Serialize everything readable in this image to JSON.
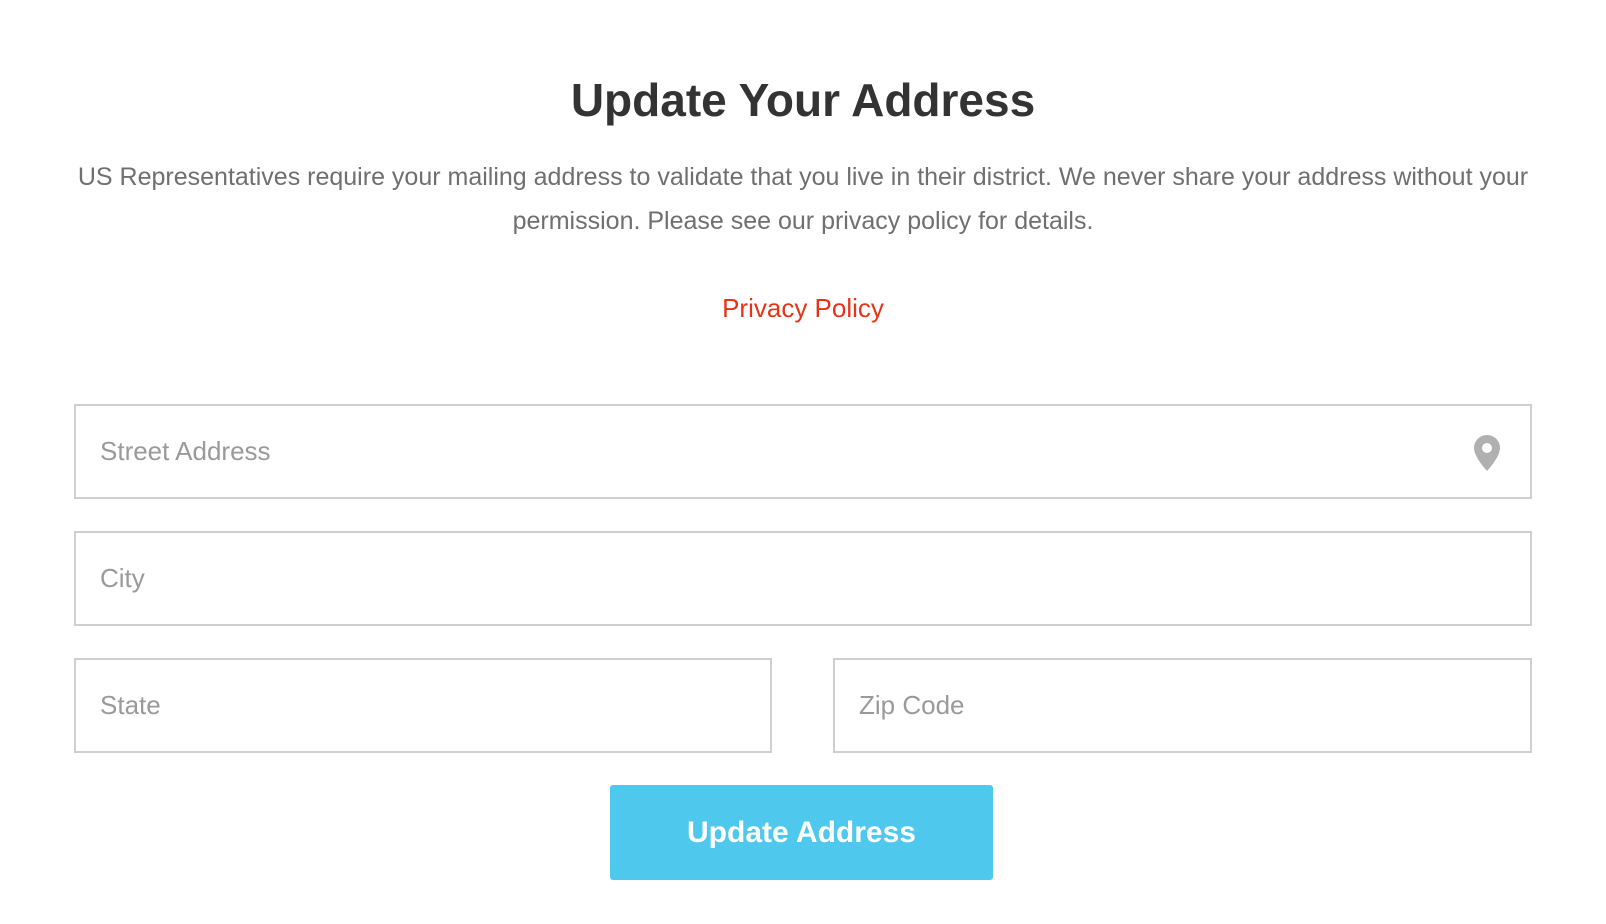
{
  "header": {
    "title": "Update Your Address",
    "description": "US Representatives require your mailing address to validate that you live in their district. We never share your address without your permission. Please see our privacy policy for details.",
    "privacy_link": "Privacy Policy"
  },
  "form": {
    "street": {
      "placeholder": "Street Address",
      "value": "",
      "icon": "map-pin-icon"
    },
    "city": {
      "placeholder": "City",
      "value": ""
    },
    "state": {
      "placeholder": "State",
      "value": ""
    },
    "zip": {
      "placeholder": "Zip Code",
      "value": ""
    },
    "submit_label": "Update Address"
  },
  "colors": {
    "link": "#e53418",
    "button": "#4fc8ed",
    "title": "#333333",
    "text": "#6f6f6f",
    "border": "#cfcfcf"
  }
}
